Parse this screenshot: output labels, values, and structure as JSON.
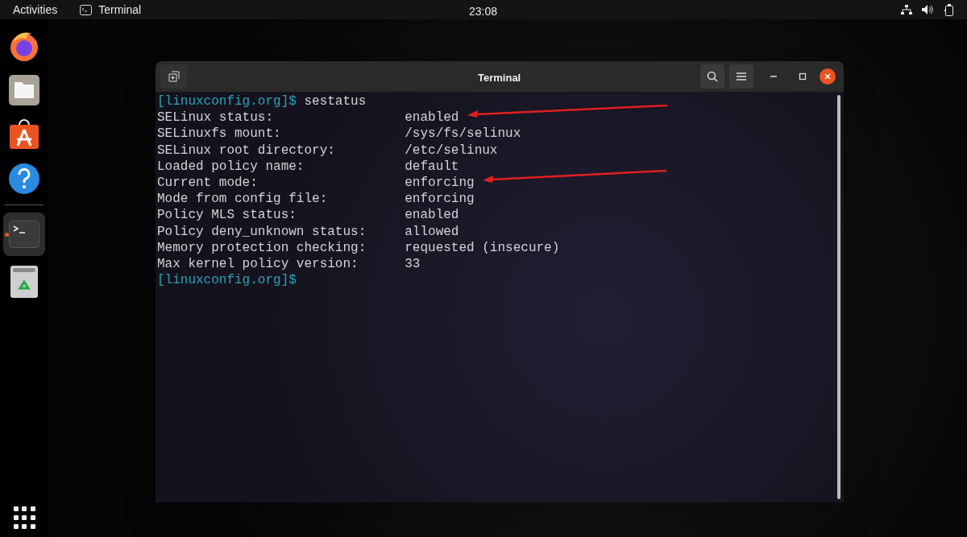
{
  "top_bar": {
    "activities": "Activities",
    "app_name": "Terminal",
    "clock": "23:08"
  },
  "dock": {
    "items": [
      {
        "kind": "browser",
        "running": false
      },
      {
        "kind": "files",
        "running": false
      },
      {
        "kind": "store",
        "running": false
      },
      {
        "kind": "help",
        "running": false
      },
      {
        "kind": "separator"
      },
      {
        "kind": "terminal",
        "running": true
      },
      {
        "kind": "trash",
        "running": false
      }
    ]
  },
  "window": {
    "title": "Terminal",
    "command": {
      "prompt": "[linuxconfig.org]$",
      "text": "sestatus"
    },
    "lines": [
      {
        "label": "SELinux status:",
        "value": "enabled",
        "arrow": true
      },
      {
        "label": "SELinuxfs mount:",
        "value": "/sys/fs/selinux",
        "arrow": false
      },
      {
        "label": "SELinux root directory:",
        "value": "/etc/selinux",
        "arrow": false
      },
      {
        "label": "Loaded policy name:",
        "value": "default",
        "arrow": false
      },
      {
        "label": "Current mode:",
        "value": "enforcing",
        "arrow": true
      },
      {
        "label": "Mode from config file:",
        "value": "enforcing",
        "arrow": false
      },
      {
        "label": "Policy MLS status:",
        "value": "enabled",
        "arrow": false
      },
      {
        "label": "Policy deny_unknown status:",
        "value": "allowed",
        "arrow": false
      },
      {
        "label": "Memory protection checking:",
        "value": "requested (insecure)",
        "arrow": false
      },
      {
        "label": "Max kernel policy version:",
        "value": "33",
        "arrow": false
      }
    ],
    "final_prompt": "[linuxconfig.org]$"
  }
}
